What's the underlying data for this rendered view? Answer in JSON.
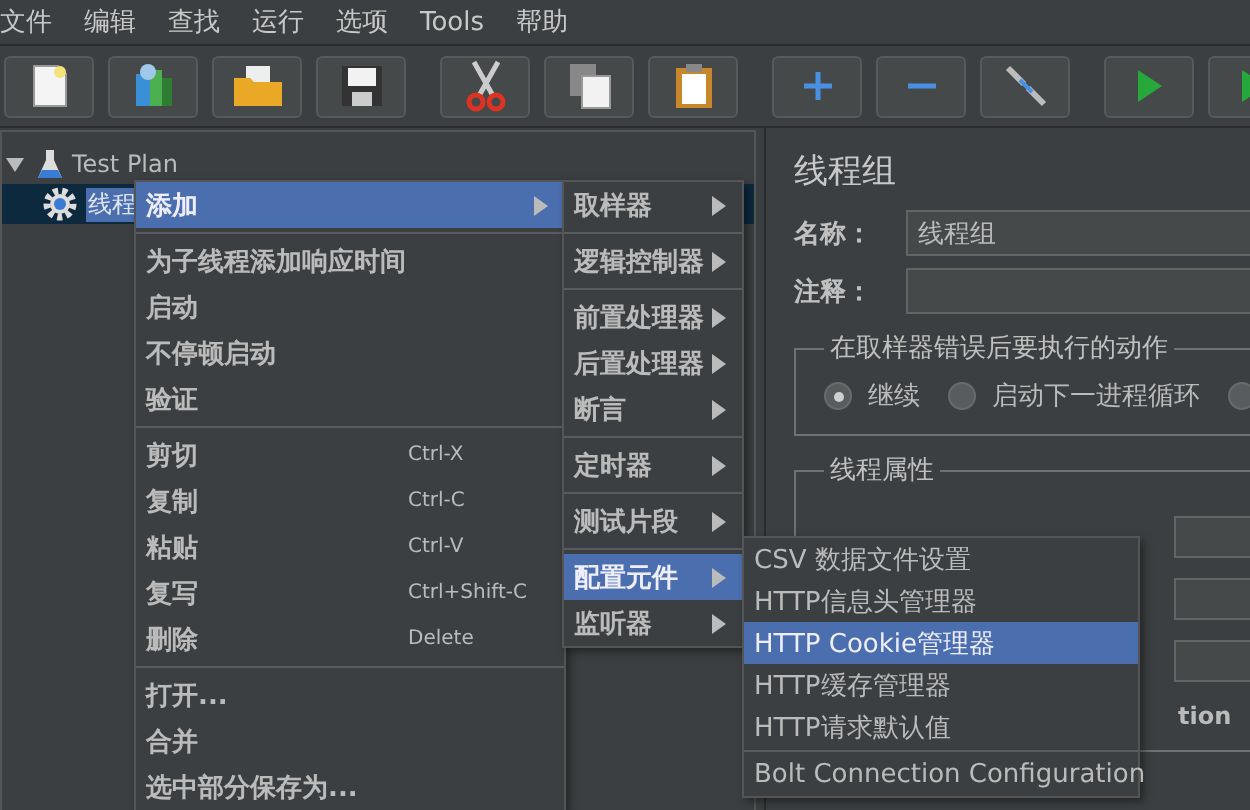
{
  "menubar": [
    {
      "label": "文件"
    },
    {
      "label": "编辑"
    },
    {
      "label": "查找"
    },
    {
      "label": "运行"
    },
    {
      "label": "选项"
    },
    {
      "label": "Tools"
    },
    {
      "label": "帮助"
    }
  ],
  "toolbar": [
    {
      "kind": "new"
    },
    {
      "kind": "templates"
    },
    {
      "kind": "open"
    },
    {
      "kind": "save"
    },
    {
      "kind": "separator"
    },
    {
      "kind": "cut"
    },
    {
      "kind": "copy"
    },
    {
      "kind": "paste"
    },
    {
      "kind": "separator"
    },
    {
      "kind": "expand"
    },
    {
      "kind": "collapse"
    },
    {
      "kind": "toggle"
    },
    {
      "kind": "separator"
    },
    {
      "kind": "start"
    },
    {
      "kind": "start-no-pause"
    }
  ],
  "tree": [
    {
      "label": "Test Plan",
      "kind": "plan",
      "expanded": true,
      "selected": false,
      "children": [
        {
          "label": "线程",
          "kind": "threads",
          "selected": true
        }
      ]
    }
  ],
  "panel": {
    "title": "线程组",
    "fields": [
      {
        "label": "名称：",
        "value": "线程组"
      },
      {
        "label": "注释："
      }
    ],
    "error_group": {
      "title": "在取样器错误后要执行的动作",
      "options": [
        {
          "label": "继续",
          "selected": true
        },
        {
          "label": "启动下一进程循环",
          "selected": false
        },
        {
          "selected": false
        }
      ]
    },
    "thread_group": {
      "title": "线程属性"
    },
    "partial_label": "tion"
  },
  "context_menu": {
    "items": [
      {
        "kind": "submenu",
        "label": "添加",
        "selected": true
      },
      {
        "kind": "separator"
      },
      {
        "kind": "item",
        "label": "为子线程添加响应时间"
      },
      {
        "kind": "item",
        "label": "启动"
      },
      {
        "kind": "item",
        "label": "不停顿启动"
      },
      {
        "kind": "item",
        "label": "验证"
      },
      {
        "kind": "separator"
      },
      {
        "kind": "item",
        "label": "剪切",
        "shortcut": "Ctrl-X"
      },
      {
        "kind": "item",
        "label": "复制",
        "shortcut": "Ctrl-C"
      },
      {
        "kind": "item",
        "label": "粘贴",
        "shortcut": "Ctrl-V"
      },
      {
        "kind": "item",
        "label": "复写",
        "shortcut": "Ctrl+Shift-C"
      },
      {
        "kind": "item",
        "label": "删除",
        "shortcut": "Delete"
      },
      {
        "kind": "separator"
      },
      {
        "kind": "item",
        "label": "打开..."
      },
      {
        "kind": "item",
        "label": "合并"
      },
      {
        "kind": "item",
        "label": "选中部分保存为..."
      }
    ]
  },
  "add_menu": {
    "items": [
      {
        "kind": "submenu",
        "label": "取样器",
        "selected": false
      },
      {
        "kind": "separator"
      },
      {
        "kind": "submenu",
        "label": "逻辑控制器",
        "selected": false
      },
      {
        "kind": "separator"
      },
      {
        "kind": "submenu",
        "label": "前置处理器",
        "selected": false
      },
      {
        "kind": "submenu",
        "label": "后置处理器",
        "selected": false
      },
      {
        "kind": "submenu",
        "label": "断言",
        "selected": false
      },
      {
        "kind": "separator"
      },
      {
        "kind": "submenu",
        "label": "定时器",
        "selected": false
      },
      {
        "kind": "separator"
      },
      {
        "kind": "submenu",
        "label": "测试片段",
        "selected": false
      },
      {
        "kind": "separator"
      },
      {
        "kind": "submenu",
        "label": "配置元件",
        "selected": true
      },
      {
        "kind": "submenu",
        "label": "监听器",
        "selected": false
      }
    ]
  },
  "config_menu": {
    "items": [
      {
        "kind": "item",
        "label": "CSV 数据文件设置",
        "selected": false
      },
      {
        "kind": "item",
        "label": "HTTP信息头管理器",
        "selected": false
      },
      {
        "kind": "item",
        "label": "HTTP Cookie管理器",
        "selected": true
      },
      {
        "kind": "item",
        "label": "HTTP缓存管理器",
        "selected": false
      },
      {
        "kind": "item",
        "label": "HTTP请求默认值",
        "selected": false
      },
      {
        "kind": "separator"
      },
      {
        "kind": "item",
        "label": "Bolt Connection Configuration",
        "selected": false
      }
    ]
  }
}
